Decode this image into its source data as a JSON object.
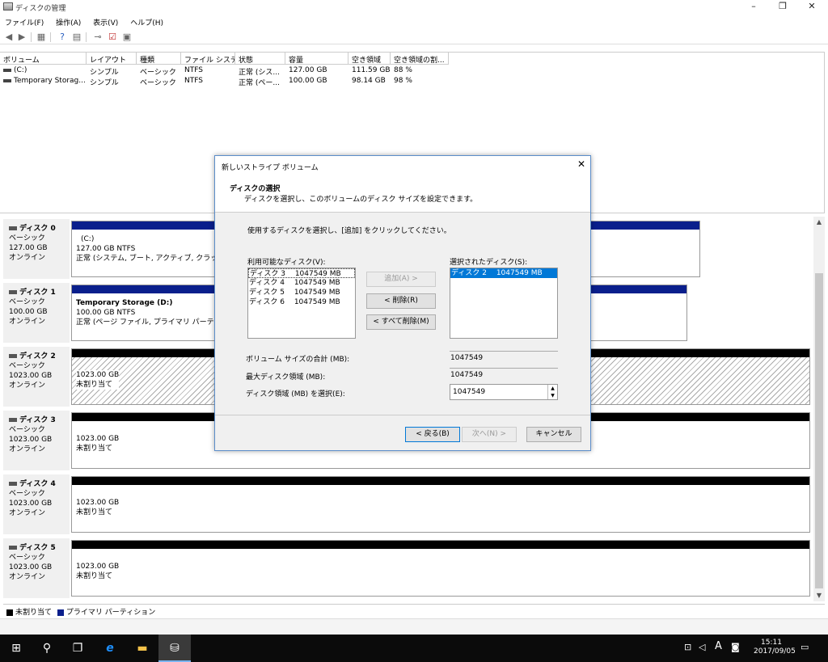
{
  "window": {
    "title": "ディスクの管理",
    "minimize": "–",
    "restore": "❐",
    "close": "✕"
  },
  "menu": [
    "ファイル(F)",
    "操作(A)",
    "表示(V)",
    "ヘルプ(H)"
  ],
  "volumes": {
    "columns": [
      "ボリューム",
      "レイアウト",
      "種類",
      "ファイル システム",
      "状態",
      "容量",
      "空き領域",
      "空き領域の割..."
    ],
    "rows": [
      [
        "(C:)",
        "シンプル",
        "ベーシック",
        "NTFS",
        "正常 (シス...",
        "127.00 GB",
        "111.59 GB",
        "88 %"
      ],
      [
        "Temporary Storag...",
        "シンプル",
        "ベーシック",
        "NTFS",
        "正常 (ペー...",
        "100.00 GB",
        "98.14 GB",
        "98 %"
      ]
    ]
  },
  "disks": [
    {
      "name": "ディスク 0",
      "type": "ベーシック",
      "size": "127.00 GB",
      "status": "オンライン",
      "part_title": "(C:)",
      "part_size": "127.00 GB NTFS",
      "part_status": "正常 (システム, ブート, アクティブ, クラッシュ ダン"
    },
    {
      "name": "ディスク 1",
      "type": "ベーシック",
      "size": "100.00 GB",
      "status": "オンライン",
      "part_title": "Temporary Storage (D:)",
      "part_size": "100.00 GB NTFS",
      "part_status": "正常 (ページ ファイル, プライマリ パーティション)"
    },
    {
      "name": "ディスク 2",
      "type": "ベーシック",
      "size": "1023.00 GB",
      "status": "オンライン",
      "part_size": "1023.00 GB",
      "part_status": "未割り当て"
    },
    {
      "name": "ディスク 3",
      "type": "ベーシック",
      "size": "1023.00 GB",
      "status": "オンライン",
      "part_size": "1023.00 GB",
      "part_status": "未割り当て"
    },
    {
      "name": "ディスク 4",
      "type": "ベーシック",
      "size": "1023.00 GB",
      "status": "オンライン",
      "part_size": "1023.00 GB",
      "part_status": "未割り当て"
    },
    {
      "name": "ディスク 5",
      "type": "ベーシック",
      "size": "1023.00 GB",
      "status": "オンライン",
      "part_size": "1023.00 GB",
      "part_status": "未割り当て"
    }
  ],
  "legend": {
    "unalloc": "未割り当て",
    "primary": "プライマリ パーティション"
  },
  "colors": {
    "primary": "#0a1f8c",
    "unalloc": "#000000",
    "selection": "#0078d7"
  },
  "dialog": {
    "title": "新しいストライプ ボリューム",
    "heading": "ディスクの選択",
    "subheading": "ディスクを選択し、このボリュームのディスク サイズを設定できます。",
    "instruction": "使用するディスクを選択し、[追加] をクリックしてください。",
    "available_label": "利用可能なディスク(V):",
    "available": [
      "ディスク 3　 1047549 MB",
      "ディスク 4　 1047549 MB",
      "ディスク 5　 1047549 MB",
      "ディスク 6　 1047549 MB"
    ],
    "selected_label": "選択されたディスク(S):",
    "selected": [
      "ディスク 2　 1047549 MB"
    ],
    "add": "追加(A) >",
    "remove": "< 削除(R)",
    "remove_all": "< すべて削除(M)",
    "total_label": "ボリューム サイズの合計 (MB):",
    "total_value": "1047549",
    "max_label": "最大ディスク領域 (MB):",
    "max_value": "1047549",
    "select_label": "ディスク領域 (MB) を選択(E):",
    "select_value": "1047549",
    "back": "< 戻る(B)",
    "next": "次へ(N) >",
    "cancel": "キャンセル"
  },
  "taskbar": {
    "time": "15:11",
    "date": "2017/09/05",
    "ime": "A"
  }
}
